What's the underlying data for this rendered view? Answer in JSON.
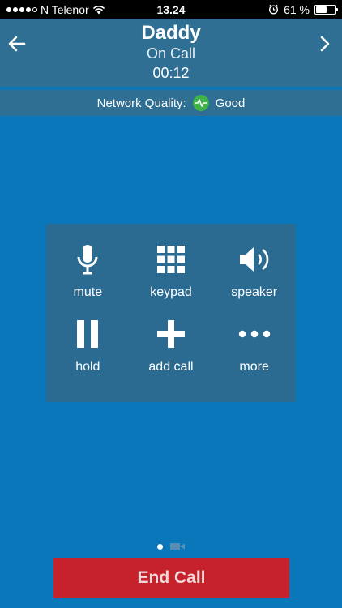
{
  "status_bar": {
    "carrier": "N Telenor",
    "time": "13.24",
    "battery_percent": "61 %",
    "battery_level": 0.61,
    "signal_bars_filled": 4
  },
  "call": {
    "contact_name": "Daddy",
    "state": "On Call",
    "duration": "00:12"
  },
  "network": {
    "label": "Network Quality:",
    "value": "Good",
    "indicator_color": "#3fb24a"
  },
  "controls": {
    "mute": {
      "label": "mute",
      "icon": "microphone-icon"
    },
    "keypad": {
      "label": "keypad",
      "icon": "keypad-grid-icon"
    },
    "speaker": {
      "label": "speaker",
      "icon": "speaker-icon"
    },
    "hold": {
      "label": "hold",
      "icon": "pause-icon"
    },
    "add_call": {
      "label": "add call",
      "icon": "plus-icon"
    },
    "more": {
      "label": "more",
      "icon": "more-dots-icon"
    }
  },
  "pager": {
    "active_page": 1,
    "second_page_icon": "video-camera-icon"
  },
  "end_call": {
    "label": "End Call",
    "color": "#c5222c"
  },
  "colors": {
    "background": "#0b77bb",
    "header": "#2f6f94",
    "panel": "#2b6b92"
  }
}
